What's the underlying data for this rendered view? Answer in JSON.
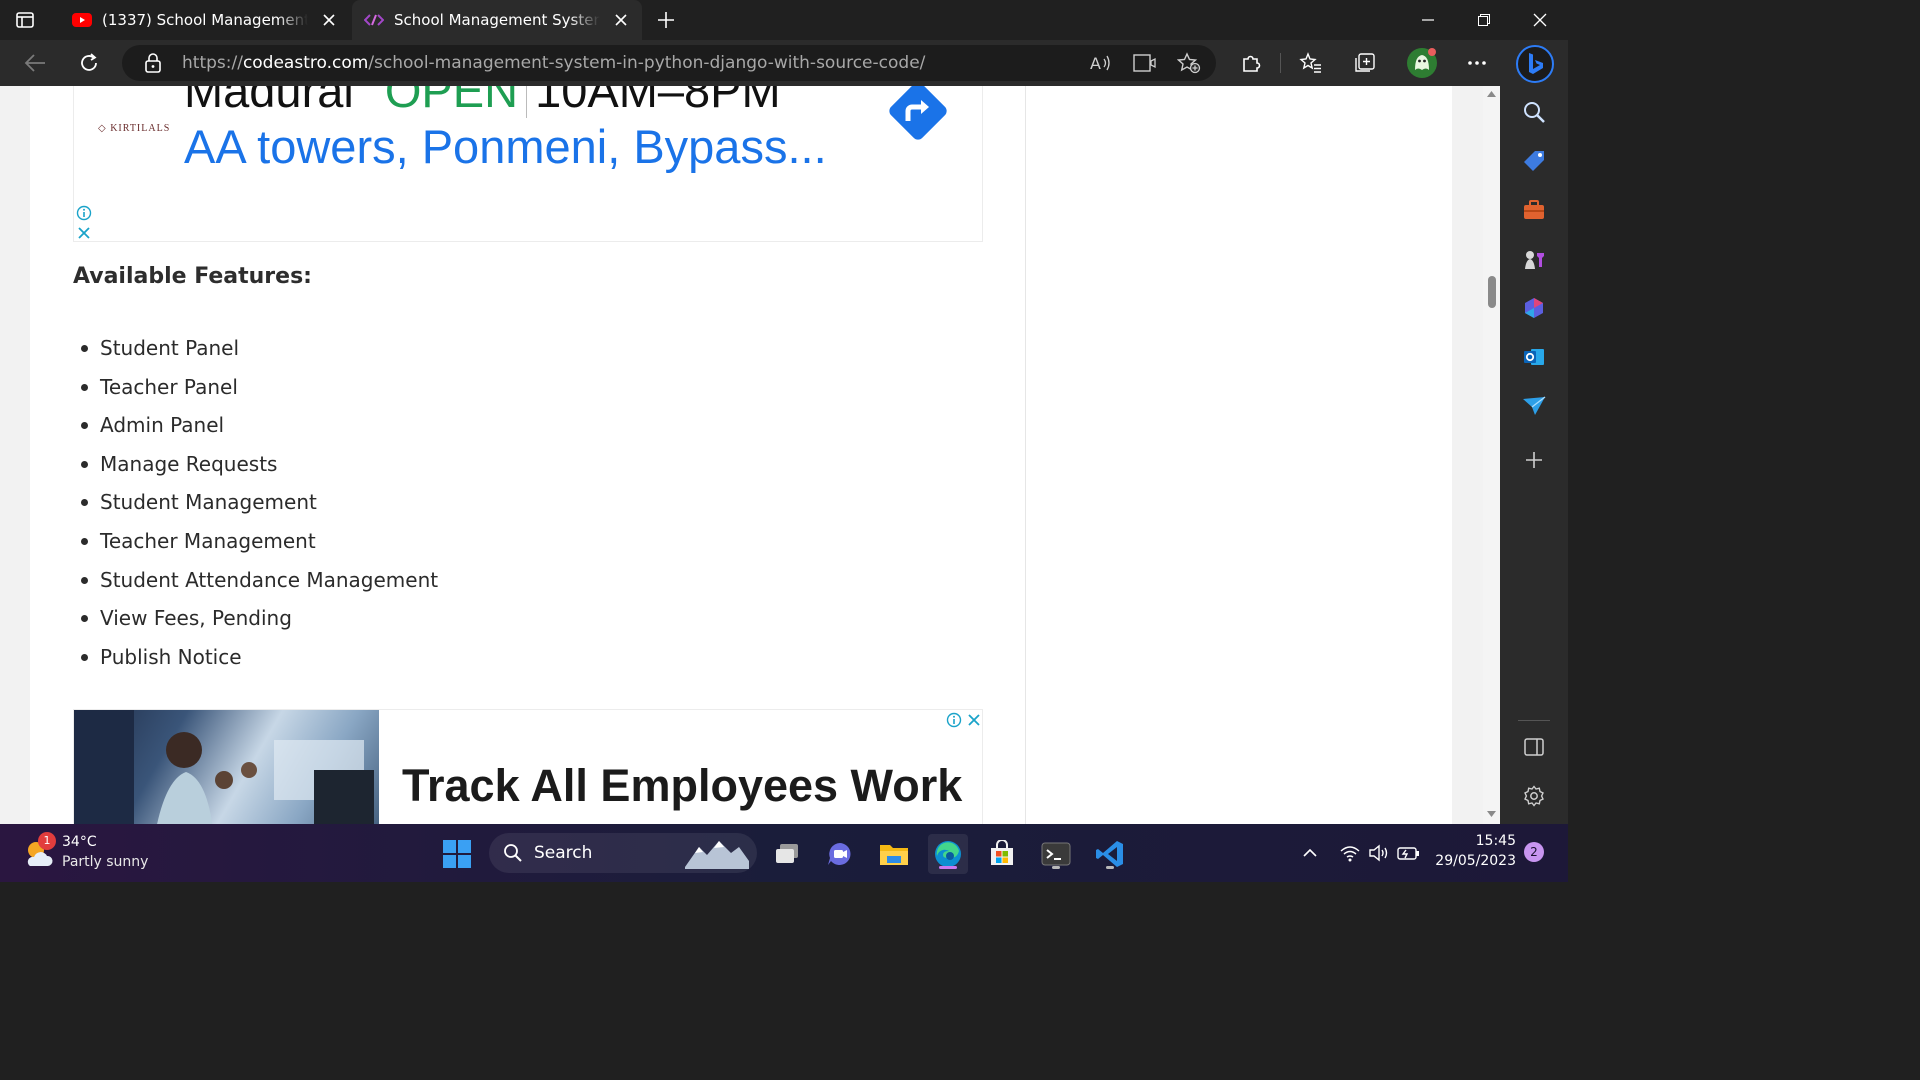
{
  "browser": {
    "tabs": [
      {
        "title": "(1337) School Management System",
        "favicon": "youtube-icon"
      },
      {
        "title": "School Management System in Python",
        "favicon": "codeastro-icon"
      }
    ],
    "url": {
      "scheme": "https://",
      "domain": "codeastro.com",
      "path": "/school-management-system-in-python-django-with-source-code/"
    }
  },
  "ad_top": {
    "brand": "KIRTILALS",
    "city": "Madurai",
    "status": "OPEN",
    "hours": "10AM–8PM",
    "address": "AA towers, Ponmeni, Bypass..."
  },
  "article": {
    "heading": "Available Features:",
    "features": [
      "Student Panel",
      "Teacher Panel",
      "Admin Panel",
      "Manage Requests",
      "Student Management",
      "Teacher Management",
      "Student Attendance Management",
      "View Fees, Pending",
      "Publish Notice"
    ]
  },
  "ad_bottom": {
    "headline": "Track All Employees Work"
  },
  "taskbar": {
    "weather": {
      "temp": "34°C",
      "condition": "Partly sunny",
      "badge": "1"
    },
    "search_label": "Search",
    "time": "15:45",
    "date": "29/05/2023",
    "notifications": "2"
  },
  "colors": {
    "open_green": "#1e9e52",
    "address_blue": "#1a73e8",
    "accent_purple": "#c87aef"
  }
}
